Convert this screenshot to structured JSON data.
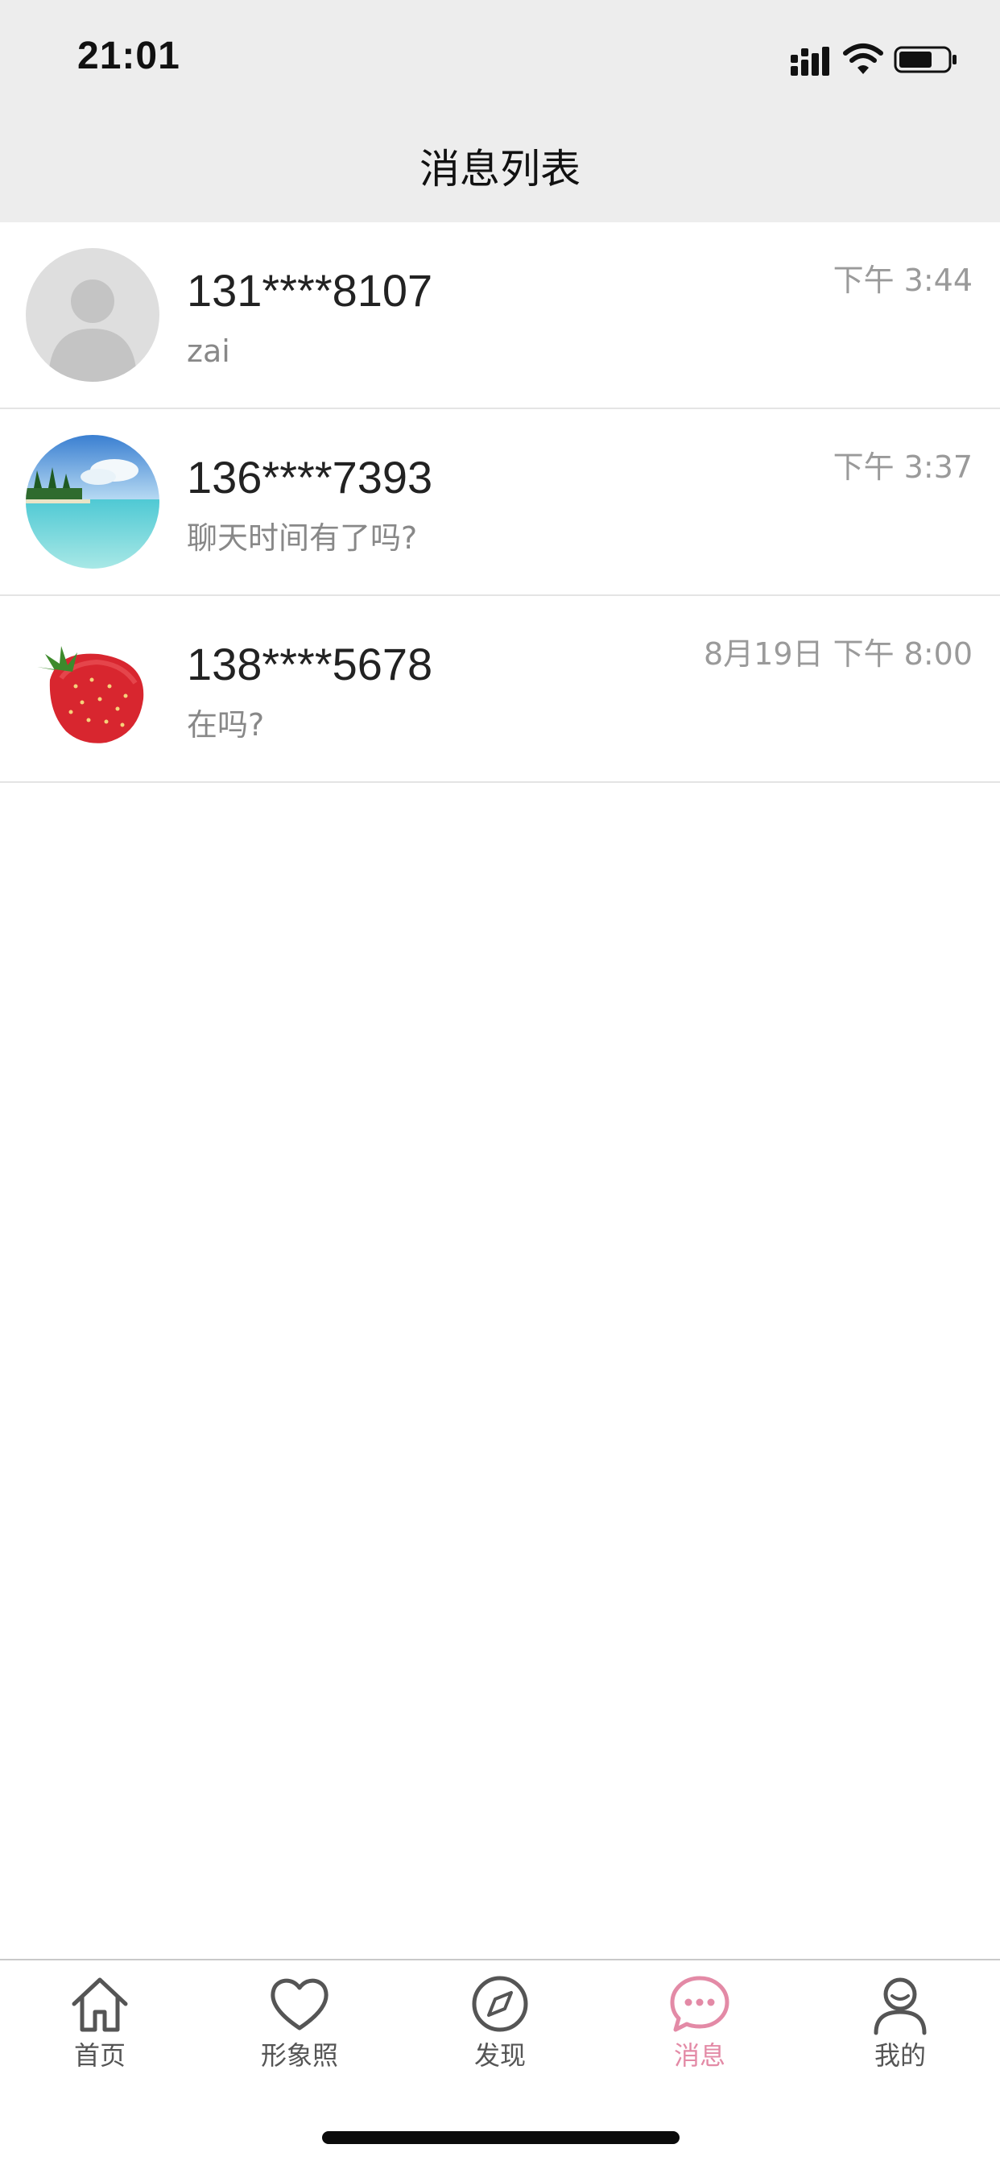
{
  "status_bar": {
    "time": "21:01",
    "icons": [
      "cellular-signal-icon",
      "wifi-icon",
      "battery-icon"
    ]
  },
  "nav": {
    "title": "消息列表"
  },
  "conversations": [
    {
      "name": "131****8107",
      "message": "zai",
      "time": "下午 3:44",
      "avatar": "default-avatar"
    },
    {
      "name": "136****7393",
      "message": "聊天时间有了吗?",
      "time": "下午 3:37",
      "avatar": "beach-photo"
    },
    {
      "name": "138****5678",
      "message": "在吗?",
      "time": "8月19日 下午 8:00",
      "avatar": "strawberry-photo"
    }
  ],
  "tabs": [
    {
      "label": "首页",
      "icon": "home-icon",
      "active": false
    },
    {
      "label": "形象照",
      "icon": "heart-icon",
      "active": false
    },
    {
      "label": "发现",
      "icon": "compass-icon",
      "active": false
    },
    {
      "label": "消息",
      "icon": "chat-bubble-icon",
      "active": true
    },
    {
      "label": "我的",
      "icon": "user-icon",
      "active": false
    }
  ],
  "colors": {
    "header_bg": "#ededed",
    "active_tab": "#e38aa6",
    "inactive_tab": "#555555",
    "divider": "#e4e4e4"
  }
}
